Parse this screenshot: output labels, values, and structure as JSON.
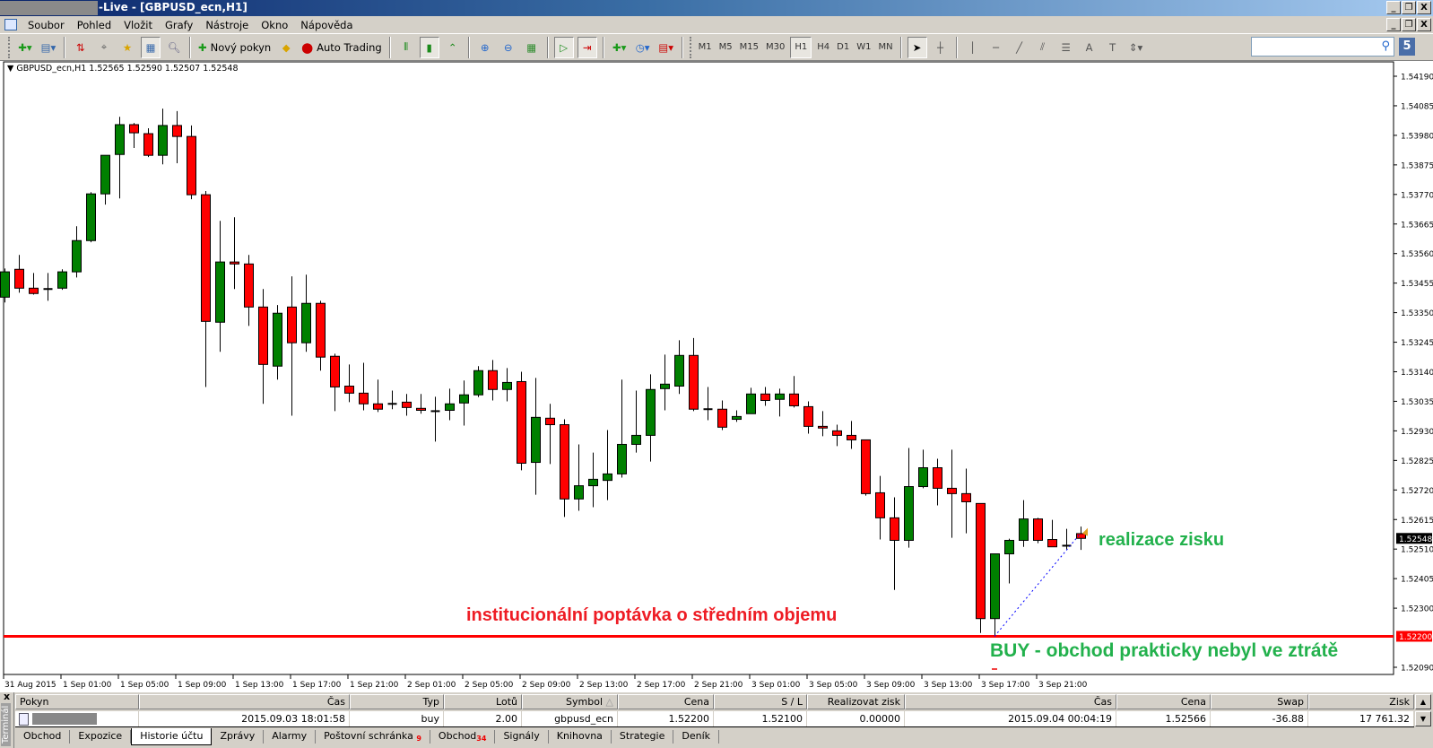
{
  "window": {
    "title": "-Live - [GBPUSD_ecn,H1]",
    "controls": [
      "_",
      "̅□",
      "X"
    ]
  },
  "menu": [
    "Soubor",
    "Pohled",
    "Vložit",
    "Grafy",
    "Nástroje",
    "Okno",
    "Nápověda"
  ],
  "toolbar": {
    "new_order": "Nový pokyn",
    "auto_trading": "Auto Trading",
    "timeframes": [
      "M1",
      "M5",
      "M15",
      "M30",
      "H1",
      "H4",
      "D1",
      "W1",
      "MN"
    ],
    "active_timeframe": "H1",
    "search_placeholder": "",
    "badge": "5"
  },
  "chart_info": "GBPUSD_ecn,H1  1.52565 1.52590 1.52507 1.52548",
  "annotations": {
    "demand": "institucionální poptávka o středním objemu",
    "profit": "realizace zisku",
    "buy": "BUY - obchod prakticky nebyl ve ztrátě"
  },
  "colors": {
    "bull": "#008000",
    "bear": "#ff0000",
    "level": "#ff0000",
    "ann_red": "#ee1c24",
    "ann_green": "#22b14c",
    "trade_line": "#0000ff"
  },
  "chart_data": {
    "type": "candlestick",
    "symbol": "GBPUSD_ecn",
    "timeframe": "H1",
    "ylim": [
      1.5209,
      1.5419
    ],
    "yticks": [
      "1.54190",
      "1.54085",
      "1.53980",
      "1.53875",
      "1.53770",
      "1.53665",
      "1.53560",
      "1.53455",
      "1.53350",
      "1.53245",
      "1.53140",
      "1.53035",
      "1.52930",
      "1.52825",
      "1.52720",
      "1.52615",
      "1.52510",
      "1.52405",
      "1.52300",
      "1.52090"
    ],
    "current_price": "1.52548",
    "level_price": "1.52200",
    "xlabels": [
      "31 Aug 2015",
      "1 Sep 01:00",
      "1 Sep 05:00",
      "1 Sep 09:00",
      "1 Sep 13:00",
      "1 Sep 17:00",
      "1 Sep 21:00",
      "2 Sep 01:00",
      "2 Sep 05:00",
      "2 Sep 09:00",
      "2 Sep 13:00",
      "2 Sep 17:00",
      "2 Sep 21:00",
      "3 Sep 01:00",
      "3 Sep 05:00",
      "3 Sep 09:00",
      "3 Sep 13:00",
      "3 Sep 17:00",
      "3 Sep 21:00"
    ],
    "ohlc": [
      [
        1.53405,
        1.53507,
        1.53386,
        1.53495
      ],
      [
        1.53504,
        1.53555,
        1.53421,
        1.53437
      ],
      [
        1.53437,
        1.53491,
        1.53414,
        1.53418
      ],
      [
        1.53434,
        1.53491,
        1.53392,
        1.53431
      ],
      [
        1.53437,
        1.53504,
        1.53431,
        1.53495
      ],
      [
        1.53495,
        1.53657,
        1.53475,
        1.53606
      ],
      [
        1.53606,
        1.53778,
        1.536,
        1.53772
      ],
      [
        1.53772,
        1.53909,
        1.53734,
        1.53909
      ],
      [
        1.53912,
        1.54046,
        1.53756,
        1.54018
      ],
      [
        1.54018,
        1.54024,
        1.53935,
        1.53989
      ],
      [
        1.53986,
        1.54005,
        1.53903,
        1.53909
      ],
      [
        1.53909,
        1.54075,
        1.53877,
        1.54015
      ],
      [
        1.54015,
        1.54066,
        1.53881,
        1.53976
      ],
      [
        1.53976,
        1.54015,
        1.53753,
        1.53769
      ],
      [
        1.53769,
        1.53782,
        1.53086,
        1.53319
      ],
      [
        1.53316,
        1.53676,
        1.53211,
        1.5353
      ],
      [
        1.5353,
        1.53689,
        1.53434,
        1.53523
      ],
      [
        1.53523,
        1.53555,
        1.53303,
        1.5337
      ],
      [
        1.5337,
        1.53434,
        1.53026,
        1.53166
      ],
      [
        1.5316,
        1.53377,
        1.53112,
        1.53348
      ],
      [
        1.5337,
        1.53479,
        1.52984,
        1.53243
      ],
      [
        1.53243,
        1.53485,
        1.53211,
        1.53383
      ],
      [
        1.53383,
        1.53392,
        1.53144,
        1.53192
      ],
      [
        1.53195,
        1.53204,
        1.53,
        1.53086
      ],
      [
        1.53089,
        1.53166,
        1.53032,
        1.53064
      ],
      [
        1.53064,
        1.53172,
        1.53003,
        1.53026
      ],
      [
        1.53026,
        1.53112,
        1.52997,
        1.53007
      ],
      [
        1.53026,
        1.53073,
        1.53007,
        1.53023
      ],
      [
        1.53032,
        1.53061,
        1.52984,
        1.53013
      ],
      [
        1.5301,
        1.53061,
        1.52991,
        1.53003
      ],
      [
        1.53,
        1.53051,
        1.52892,
        1.52997
      ],
      [
        1.53003,
        1.5308,
        1.52968,
        1.53026
      ],
      [
        1.53029,
        1.53109,
        1.52949,
        1.53058
      ],
      [
        1.53058,
        1.5316,
        1.5305,
        1.53144
      ],
      [
        1.53144,
        1.53182,
        1.53038,
        1.53077
      ],
      [
        1.53077,
        1.53153,
        1.53035,
        1.53102
      ],
      [
        1.53105,
        1.5314,
        1.5279,
        1.52815
      ],
      [
        1.52818,
        1.53118,
        1.52703,
        1.52978
      ],
      [
        1.52975,
        1.53026,
        1.52812,
        1.52952
      ],
      [
        1.52952,
        1.52971,
        1.52624,
        1.52688
      ],
      [
        1.52688,
        1.52882,
        1.52646,
        1.52735
      ],
      [
        1.52735,
        1.52853,
        1.52659,
        1.52758
      ],
      [
        1.52754,
        1.52933,
        1.52684,
        1.52777
      ],
      [
        1.52777,
        1.53112,
        1.52764,
        1.52882
      ],
      [
        1.52882,
        1.53073,
        1.52853,
        1.52914
      ],
      [
        1.52914,
        1.53131,
        1.52821,
        1.53077
      ],
      [
        1.5308,
        1.53201,
        1.53003,
        1.53096
      ],
      [
        1.53089,
        1.53252,
        1.53061,
        1.53198
      ],
      [
        1.53198,
        1.5326,
        1.53,
        1.53007
      ],
      [
        1.53007,
        1.53086,
        1.52968,
        1.53007
      ],
      [
        1.53007,
        1.53038,
        1.52933,
        1.52943
      ],
      [
        1.52971,
        1.53003,
        1.52962,
        1.52981
      ],
      [
        1.52991,
        1.53083,
        1.52991,
        1.53061
      ],
      [
        1.53061,
        1.53086,
        1.53019,
        1.53038
      ],
      [
        1.53042,
        1.5308,
        1.52981,
        1.53061
      ],
      [
        1.53061,
        1.53125,
        1.53013,
        1.53019
      ],
      [
        1.53016,
        1.53035,
        1.5292,
        1.52946
      ],
      [
        1.52946,
        1.53,
        1.52911,
        1.5294
      ],
      [
        1.5293,
        1.52952,
        1.52876,
        1.52914
      ],
      [
        1.52914,
        1.52965,
        1.52866,
        1.52898
      ],
      [
        1.52898,
        1.52898,
        1.527,
        1.52707
      ],
      [
        1.5271,
        1.5277,
        1.52544,
        1.52621
      ],
      [
        1.52621,
        1.52694,
        1.52365,
        1.52541
      ],
      [
        1.52541,
        1.52869,
        1.52515,
        1.52732
      ],
      [
        1.52732,
        1.52863,
        1.52726,
        1.52799
      ],
      [
        1.52799,
        1.52831,
        1.52665,
        1.52726
      ],
      [
        1.52726,
        1.52863,
        1.5255,
        1.52707
      ],
      [
        1.52707,
        1.52796,
        1.52566,
        1.52678
      ],
      [
        1.52672,
        1.52672,
        1.52212,
        1.52263
      ],
      [
        1.52263,
        1.52493,
        1.522,
        1.52493
      ],
      [
        1.52493,
        1.52547,
        1.52388,
        1.52541
      ],
      [
        1.52541,
        1.52684,
        1.52518,
        1.52617
      ],
      [
        1.52617,
        1.52621,
        1.52531,
        1.52541
      ],
      [
        1.52544,
        1.52614,
        1.52518,
        1.52518
      ],
      [
        1.52522,
        1.52582,
        1.52509,
        1.52522
      ],
      [
        1.52565,
        1.5259,
        1.52507,
        1.52548
      ]
    ],
    "trade": {
      "entry_index": 69,
      "entry_price": 1.522,
      "exit_index": 75,
      "exit_price": 1.52566
    }
  },
  "terminal": {
    "label": "Terminál",
    "close": "x",
    "columns": [
      "Pokyn",
      "Čas",
      "Typ",
      "Lotů",
      "Symbol",
      "Cena",
      "S / L",
      "Realizovat zisk",
      "Čas",
      "Cena",
      "Swap",
      "Zisk"
    ],
    "sort_indicator": "△",
    "row": {
      "time_open": "2015.09.03 18:01:58",
      "type": "buy",
      "lots": "2.00",
      "symbol": "gbpusd_ecn",
      "price_open": "1.52200",
      "sl": "1.52100",
      "tp": "0.00000",
      "time_close": "2015.09.04 00:04:19",
      "price_close": "1.52566",
      "swap": "-36.88",
      "profit": "17 761.32"
    },
    "tabs": [
      {
        "label": "Obchod"
      },
      {
        "label": "Expozice"
      },
      {
        "label": "Historie účtu"
      },
      {
        "label": "Zprávy"
      },
      {
        "label": "Alarmy"
      },
      {
        "label": "Poštovní schránka",
        "count": "9"
      },
      {
        "label": "Obchod",
        "count": "34"
      },
      {
        "label": "Signály"
      },
      {
        "label": "Knihovna"
      },
      {
        "label": "Strategie"
      },
      {
        "label": "Deník"
      }
    ]
  }
}
